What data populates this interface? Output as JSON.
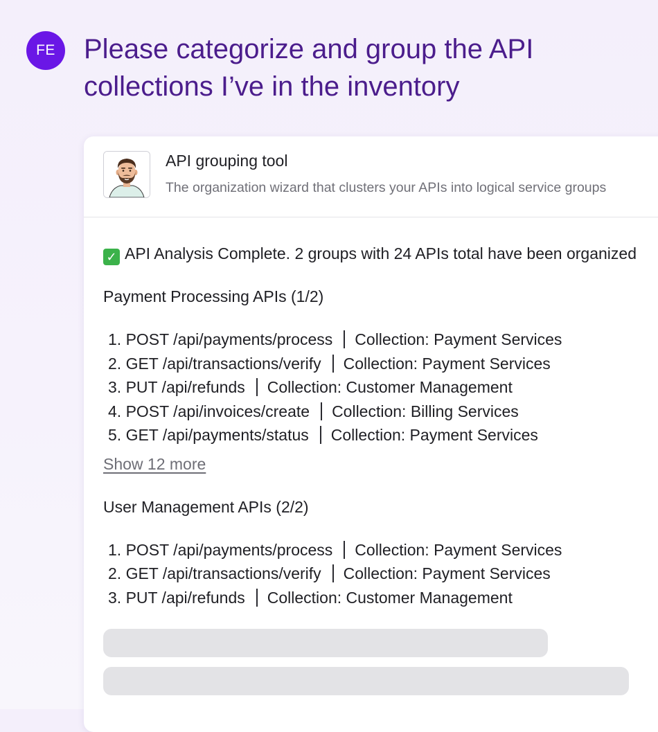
{
  "user": {
    "initials": "FE",
    "prompt": "Please categorize and group the API collections I’ve in the inventory"
  },
  "tool": {
    "avatar_icon": "bearded-man-avatar",
    "title": "API grouping tool",
    "subtitle": "The organization wizard that clusters your APIs into logical service groups"
  },
  "result": {
    "check_icon": "check-mark-icon",
    "summary": "API Analysis Complete. 2 groups with 24 APIs total have been organized",
    "groups": [
      {
        "title": "Payment Processing APIs (1/2)",
        "items": [
          {
            "index": "1.",
            "endpoint": "POST /api/payments/process",
            "collection": "Collection: Payment Services"
          },
          {
            "index": "2.",
            "endpoint": "GET /api/transactions/verify",
            "collection": "Collection: Payment Services"
          },
          {
            "index": "3.",
            "endpoint": "PUT /api/refunds",
            "collection": "Collection: Customer Management"
          },
          {
            "index": "4.",
            "endpoint": "POST /api/invoices/create",
            "collection": "Collection: Billing Services"
          },
          {
            "index": "5.",
            "endpoint": "GET /api/payments/status",
            "collection": "Collection: Payment Services"
          }
        ],
        "show_more": "Show 12 more"
      },
      {
        "title": "User Management APIs (2/2)",
        "items": [
          {
            "index": "1.",
            "endpoint": "POST /api/payments/process",
            "collection": "Collection: Payment Services"
          },
          {
            "index": "2.",
            "endpoint": "GET /api/transactions/verify",
            "collection": "Collection: Payment Services"
          },
          {
            "index": "3.",
            "endpoint": "PUT /api/refunds",
            "collection": "Collection: Customer Management"
          }
        ]
      }
    ]
  },
  "colors": {
    "avatar_bg": "#6a17e6",
    "prompt_text": "#4b1d8c",
    "check_green": "#3bb24a",
    "skeleton": "#e3e3e6"
  }
}
